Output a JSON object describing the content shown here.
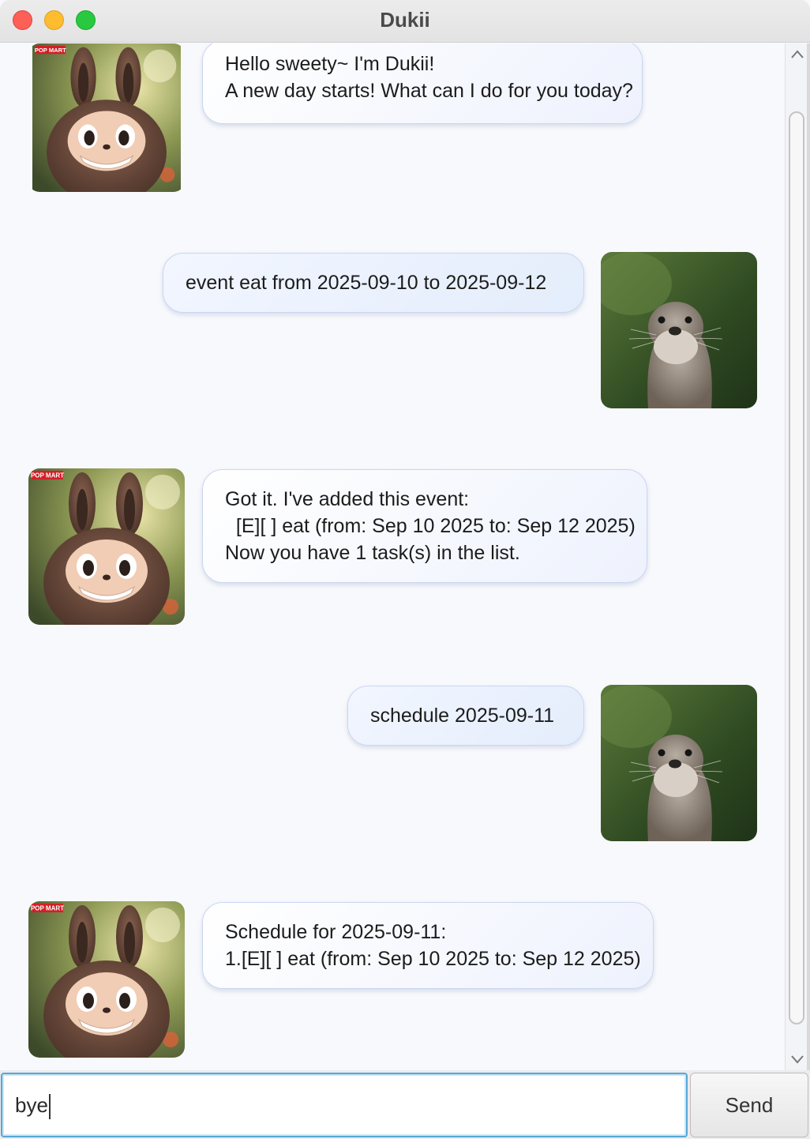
{
  "window": {
    "title": "Dukii"
  },
  "messages": [
    {
      "sender": "bot",
      "avatar": "labubu-doll",
      "text": "Hello sweety~ I'm Dukii!\nA new day starts! What can I do for you today?"
    },
    {
      "sender": "user",
      "avatar": "otter",
      "text": "event eat from 2025-09-10 to 2025-09-12"
    },
    {
      "sender": "bot",
      "avatar": "labubu-doll",
      "text": "Got it. I've added this event:\n  [E][ ] eat (from: Sep 10 2025 to: Sep 12 2025)\nNow you have 1 task(s) in the list."
    },
    {
      "sender": "user",
      "avatar": "otter",
      "text": "schedule 2025-09-11"
    },
    {
      "sender": "bot",
      "avatar": "labubu-doll",
      "text": "Schedule for 2025-09-11:\n1.[E][ ] eat (from: Sep 10 2025 to: Sep 12 2025)"
    }
  ],
  "avatar_badge": "POP MART",
  "input": {
    "value": "bye"
  },
  "send_button": {
    "label": "Send"
  },
  "colors": {
    "bubble_border": "#c9d6f2",
    "input_focus": "#55a8d6",
    "close": "#fe5f57",
    "minimize": "#febc2e",
    "maximize": "#28c840"
  }
}
